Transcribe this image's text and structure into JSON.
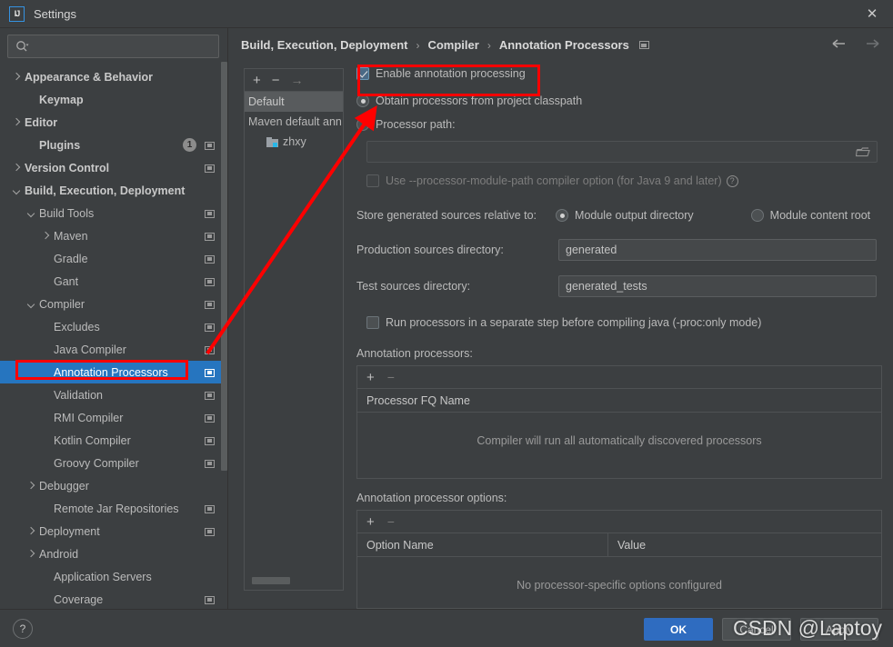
{
  "window": {
    "title": "Settings",
    "app_icon": "IJ",
    "close_icon": "✕"
  },
  "search": {
    "placeholder": "",
    "value": "",
    "icon": "search-icon"
  },
  "sidebar": {
    "items": [
      {
        "label": "Appearance & Behavior",
        "indent": 0,
        "arrow": "right",
        "bold": true,
        "badge": "",
        "proj_icon": false,
        "selected": false
      },
      {
        "label": "Keymap",
        "indent": 1,
        "arrow": "",
        "bold": true,
        "badge": "",
        "proj_icon": false,
        "selected": false
      },
      {
        "label": "Editor",
        "indent": 0,
        "arrow": "right",
        "bold": true,
        "badge": "",
        "proj_icon": false,
        "selected": false
      },
      {
        "label": "Plugins",
        "indent": 1,
        "arrow": "",
        "bold": true,
        "badge": "1",
        "proj_icon": true,
        "selected": false
      },
      {
        "label": "Version Control",
        "indent": 0,
        "arrow": "right",
        "bold": true,
        "badge": "",
        "proj_icon": true,
        "selected": false
      },
      {
        "label": "Build, Execution, Deployment",
        "indent": 0,
        "arrow": "down",
        "bold": true,
        "badge": "",
        "proj_icon": false,
        "selected": false
      },
      {
        "label": "Build Tools",
        "indent": 1,
        "arrow": "down",
        "bold": false,
        "badge": "",
        "proj_icon": true,
        "selected": false
      },
      {
        "label": "Maven",
        "indent": 2,
        "arrow": "right",
        "bold": false,
        "badge": "",
        "proj_icon": true,
        "selected": false
      },
      {
        "label": "Gradle",
        "indent": 3,
        "arrow": "",
        "bold": false,
        "badge": "",
        "proj_icon": true,
        "selected": false
      },
      {
        "label": "Gant",
        "indent": 3,
        "arrow": "",
        "bold": false,
        "badge": "",
        "proj_icon": true,
        "selected": false
      },
      {
        "label": "Compiler",
        "indent": 1,
        "arrow": "down",
        "bold": false,
        "badge": "",
        "proj_icon": true,
        "selected": false
      },
      {
        "label": "Excludes",
        "indent": 3,
        "arrow": "",
        "bold": false,
        "badge": "",
        "proj_icon": true,
        "selected": false
      },
      {
        "label": "Java Compiler",
        "indent": 3,
        "arrow": "",
        "bold": false,
        "badge": "",
        "proj_icon": true,
        "selected": false
      },
      {
        "label": "Annotation Processors",
        "indent": 3,
        "arrow": "",
        "bold": false,
        "badge": "",
        "proj_icon": true,
        "selected": true
      },
      {
        "label": "Validation",
        "indent": 3,
        "arrow": "",
        "bold": false,
        "badge": "",
        "proj_icon": true,
        "selected": false
      },
      {
        "label": "RMI Compiler",
        "indent": 3,
        "arrow": "",
        "bold": false,
        "badge": "",
        "proj_icon": true,
        "selected": false
      },
      {
        "label": "Kotlin Compiler",
        "indent": 3,
        "arrow": "",
        "bold": false,
        "badge": "",
        "proj_icon": true,
        "selected": false
      },
      {
        "label": "Groovy Compiler",
        "indent": 3,
        "arrow": "",
        "bold": false,
        "badge": "",
        "proj_icon": true,
        "selected": false
      },
      {
        "label": "Debugger",
        "indent": 1,
        "arrow": "right",
        "bold": false,
        "badge": "",
        "proj_icon": false,
        "selected": false
      },
      {
        "label": "Remote Jar Repositories",
        "indent": 2,
        "arrow": "",
        "bold": false,
        "badge": "",
        "proj_icon": true,
        "selected": false
      },
      {
        "label": "Deployment",
        "indent": 1,
        "arrow": "right",
        "bold": false,
        "badge": "",
        "proj_icon": true,
        "selected": false
      },
      {
        "label": "Android",
        "indent": 1,
        "arrow": "right",
        "bold": false,
        "badge": "",
        "proj_icon": false,
        "selected": false
      },
      {
        "label": "Application Servers",
        "indent": 2,
        "arrow": "",
        "bold": false,
        "badge": "",
        "proj_icon": false,
        "selected": false
      },
      {
        "label": "Coverage",
        "indent": 2,
        "arrow": "",
        "bold": false,
        "badge": "",
        "proj_icon": true,
        "selected": false
      }
    ]
  },
  "breadcrumb": {
    "parts": [
      "Build, Execution, Deployment",
      "Compiler",
      "Annotation Processors"
    ],
    "separator": "›",
    "project_icon": "project-scope-icon"
  },
  "nav": {
    "back_icon": "arrow-left-icon",
    "forward_icon": "arrow-right-icon"
  },
  "module_panel": {
    "toolbar": {
      "add": "+",
      "remove": "−",
      "move": "→"
    },
    "items": [
      {
        "label": "Default",
        "selected": true,
        "folder": false
      },
      {
        "label": "Maven default ann",
        "selected": false,
        "folder": false
      },
      {
        "label": "zhxy",
        "selected": false,
        "folder": true
      }
    ]
  },
  "main": {
    "enable_annotation_processing": {
      "label": "Enable annotation processing",
      "checked": true
    },
    "source_mode": {
      "options": [
        {
          "label": "Obtain processors from project classpath",
          "selected": true
        },
        {
          "label": "Processor path:",
          "selected": false
        }
      ]
    },
    "processor_path": {
      "value": "",
      "enabled": false,
      "browse_icon": "folder-open-icon"
    },
    "processor_module_path": {
      "label": "Use --processor-module-path compiler option (for Java 9 and later)",
      "checked": false,
      "enabled": false,
      "help_icon": "?"
    },
    "store_generated": {
      "label": "Store generated sources relative to:",
      "options": [
        {
          "label": "Module output directory",
          "selected": true
        },
        {
          "label": "Module content root",
          "selected": false
        }
      ]
    },
    "production_sources": {
      "label": "Production sources directory:",
      "value": "generated"
    },
    "test_sources": {
      "label": "Test sources directory:",
      "value": "generated_tests"
    },
    "proc_only": {
      "label": "Run processors in a separate step before compiling java (-proc:only mode)",
      "checked": false
    },
    "processors_table": {
      "section_label": "Annotation processors:",
      "toolbar": {
        "add": "+",
        "remove": "−"
      },
      "columns": [
        "Processor FQ Name"
      ],
      "rows": [],
      "empty_text": "Compiler will run all automatically discovered processors"
    },
    "options_table": {
      "section_label": "Annotation processor options:",
      "toolbar": {
        "add": "+",
        "remove": "−"
      },
      "columns": [
        "Option Name",
        "Value"
      ],
      "rows": [],
      "empty_text": "No processor-specific options configured"
    }
  },
  "footer": {
    "help_label": "?",
    "ok_label": "OK",
    "cancel_label": "Cancel",
    "apply_label": "Apply"
  },
  "watermark": {
    "text": "CSDN @Laptoy"
  },
  "colors": {
    "accent_blue": "#2675bf",
    "ok_button": "#2f6cc0",
    "annotation_red": "#ff0000",
    "panel_bg": "#3c3f41",
    "field_bg": "#45484a"
  }
}
